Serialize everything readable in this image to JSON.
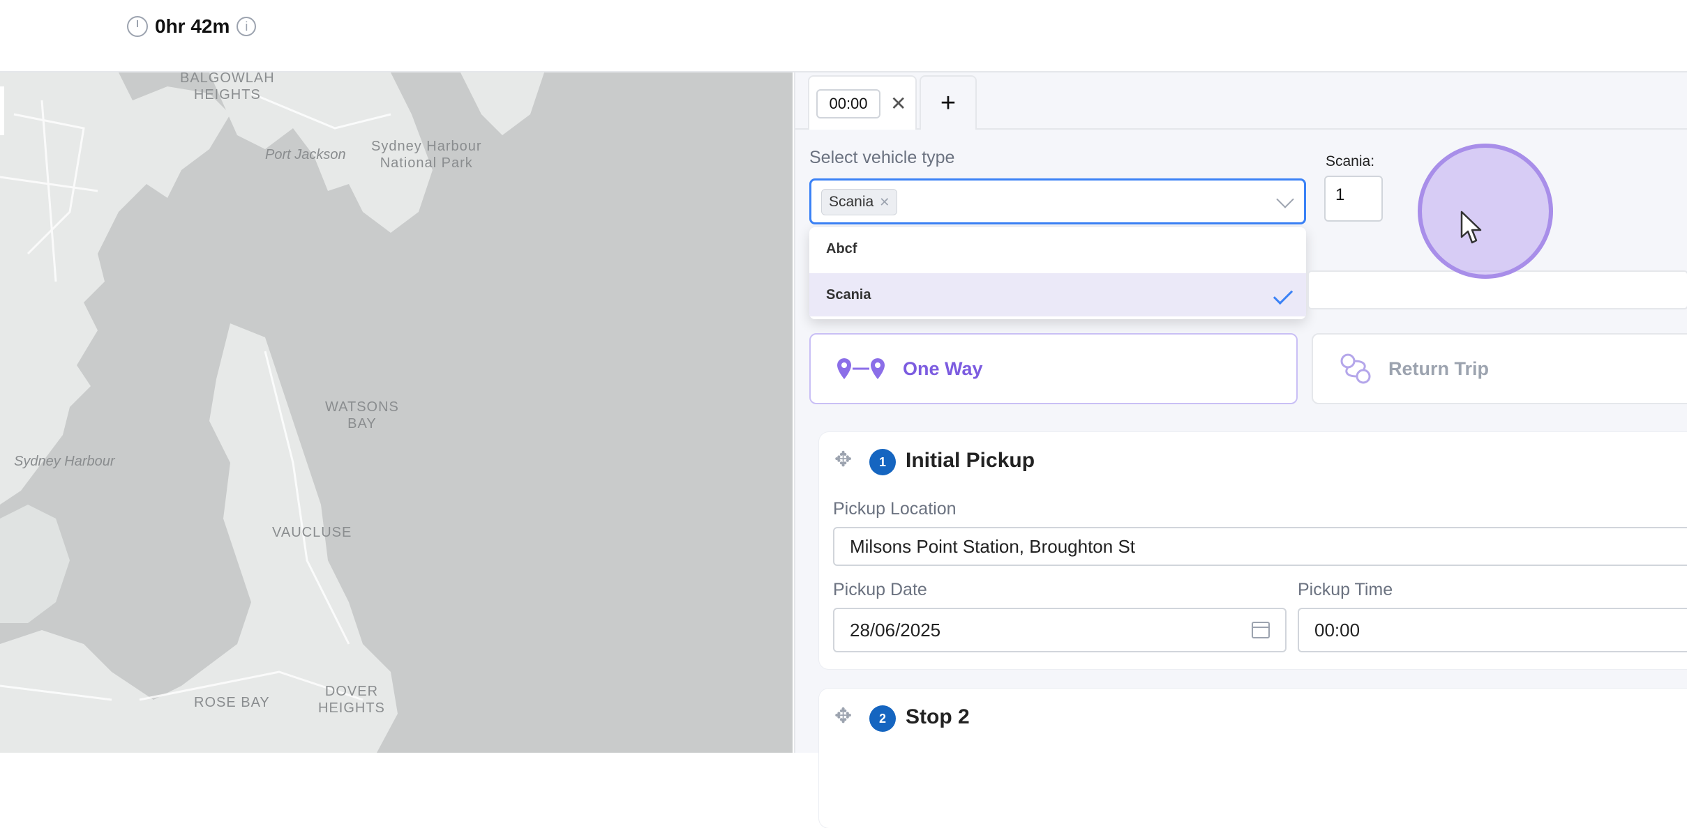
{
  "header": {
    "duration": "0hr 42m",
    "info_icon": "info-icon",
    "clock_icon": "timer-icon"
  },
  "map": {
    "labels": {
      "balgowlah": "BALGOWLAH\nHEIGHTS",
      "port_jackson": "Port Jackson",
      "sydney_harbour_np": "Sydney Harbour\nNational Park",
      "watsons_bay": "WATSONS\nBAY",
      "sydney_harbour": "Sydney Harbour",
      "vaucluse": "VAUCLUSE",
      "rose_bay": "ROSE BAY",
      "dover_heights": "DOVER\nHEIGHTS"
    }
  },
  "tabs": {
    "time": "00:00",
    "close_icon": "close-icon",
    "add_label": "+"
  },
  "vehicle": {
    "label": "Select vehicle type",
    "selected_chip": "Scania",
    "options": [
      {
        "label": "Abcf",
        "selected": false
      },
      {
        "label": "Scania",
        "selected": true
      }
    ],
    "qty_label": "Scania:",
    "qty_value": "1"
  },
  "trip_type": {
    "one_way": "One Way",
    "return_trip": "Return Trip",
    "accent": "#7c5ce0"
  },
  "stops": [
    {
      "number": "1",
      "title": "Initial Pickup",
      "location_label": "Pickup Location",
      "location_value": "Milsons Point Station, Broughton St",
      "date_label": "Pickup Date",
      "date_value": "28/06/2025",
      "time_label": "Pickup Time",
      "time_value": "00:00"
    },
    {
      "number": "2",
      "title": "Stop 2"
    }
  ]
}
